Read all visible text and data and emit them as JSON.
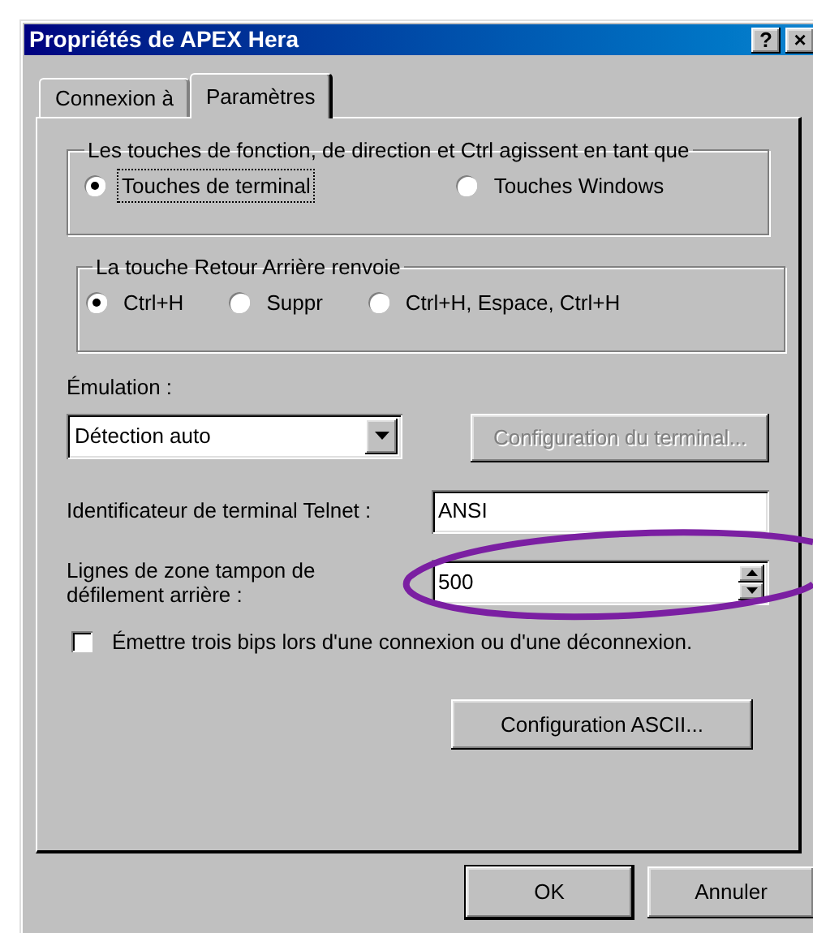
{
  "window": {
    "title": "Propriétés de APEX Hera",
    "title_buttons": [
      "?",
      "×"
    ]
  },
  "tabs": [
    {
      "label": "Connexion à",
      "selected": false
    },
    {
      "label": "Paramètres",
      "selected": true
    }
  ],
  "groups": [
    {
      "legend": "Les touches de fonction, de direction et Ctrl agissent en tant que",
      "options": [
        {
          "label": "Touches de terminal",
          "selected": true,
          "focused": true
        },
        {
          "label": "Touches Windows",
          "selected": false,
          "focused": false
        }
      ]
    },
    {
      "legend": "La touche Retour Arrière renvoie",
      "options": [
        {
          "label": "Ctrl+H",
          "selected": true,
          "focused": false
        },
        {
          "label": "Suppr",
          "selected": false,
          "focused": false
        },
        {
          "label": "Ctrl+H, Espace, Ctrl+H",
          "selected": false,
          "focused": false
        }
      ]
    }
  ],
  "emulation": {
    "label": "Émulation :",
    "value": "Détection auto"
  },
  "terminal_config_button": {
    "label": "Configuration du terminal...",
    "disabled": true
  },
  "telnet_id": {
    "label": "Identificateur de terminal Telnet :",
    "value": "ANSI"
  },
  "scrollback": {
    "label": "Lignes de zone tampon de défilement arrière :",
    "value": "500"
  },
  "beep_checkbox": {
    "label": "Émettre trois bips lors d'une connexion ou d'une déconnexion.",
    "checked": false
  },
  "ascii_button": {
    "label": "Configuration ASCII..."
  },
  "buttons": [
    {
      "label": "OK",
      "default": true
    },
    {
      "label": "Annuler",
      "default": false
    }
  ]
}
